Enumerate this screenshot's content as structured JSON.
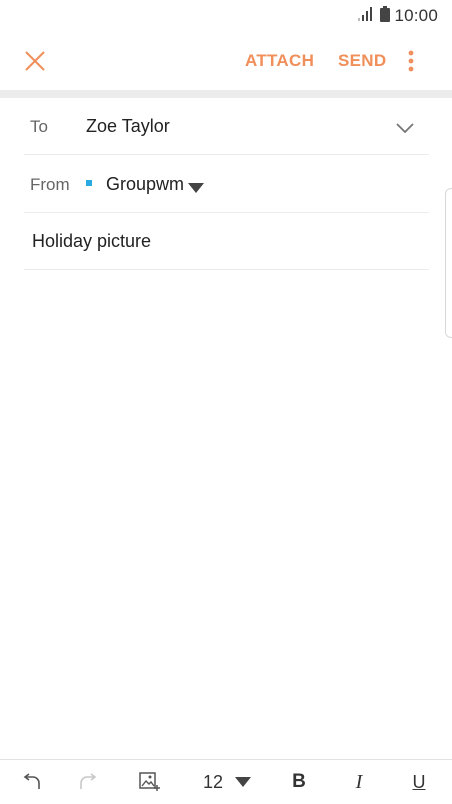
{
  "status_bar": {
    "time": "10:00",
    "signal_icon": "signal-icon",
    "battery_icon": "battery-icon"
  },
  "toolbar": {
    "close_icon": "close-icon",
    "attach_label": "ATTACH",
    "send_label": "SEND",
    "more_icon": "more-vertical-icon",
    "accent_color": "#f08f5a"
  },
  "compose": {
    "to_label": "To",
    "to_value": "Zoe Taylor",
    "from_label": "From",
    "from_value": "Groupwm",
    "account_color": "#29a9e1",
    "subject_value": "Holiday picture"
  },
  "format_bar": {
    "undo_icon": "undo-icon",
    "redo_icon": "redo-icon",
    "image_icon": "insert-image-icon",
    "font_size": "12",
    "bold_label": "B",
    "italic_label": "I",
    "underline_label": "U"
  }
}
